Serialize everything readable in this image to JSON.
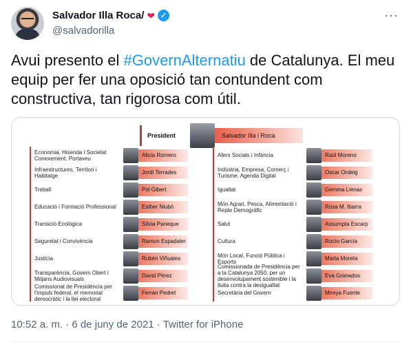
{
  "author": {
    "display_name": "Salvador Illa Roca/",
    "handle": "@salvadorilla",
    "more_label": "···"
  },
  "tweet": {
    "text_before": "Avui presento el ",
    "hashtag": "#GovernAlternatiu",
    "text_after": " de Catalunya. El meu equip per fer una oposició tan contundent com constructiva, tan rigorosa com útil."
  },
  "media": {
    "president": {
      "label": "President",
      "name": "Salvador Illa i Roca"
    },
    "left": [
      {
        "dept": "Economia, Hisenda i Societat Conexement. Portaveu",
        "name": "Alicia Romero"
      },
      {
        "dept": "Infraestructures, Territori i Habitatge",
        "name": "Jordi Terrades"
      },
      {
        "dept": "Treball",
        "name": "Pol Gibert"
      },
      {
        "dept": "Educació i Formació Professional",
        "name": "Esther Niubó"
      },
      {
        "dept": "Transició Ecològica",
        "name": "Sílvia Paneque"
      },
      {
        "dept": "Seguretat i Convivència",
        "name": "Ramon Espadaler"
      },
      {
        "dept": "Justícia",
        "name": "Rubén Viñuales"
      },
      {
        "dept": "Transparència, Govern Obert i Mitjans Audiovisuals",
        "name": "David Pérez"
      },
      {
        "dept": "Comissionat de Presidència per l'impuls federal, el memorial democràtic i la llei electoral",
        "name": "Ferran Pedret"
      }
    ],
    "right": [
      {
        "dept": "Afers Socials i Infància",
        "name": "Raül Moreno"
      },
      {
        "dept": "Indústria, Empresa, Comerç i Turisme. Agenda Digital",
        "name": "Oscar Ordeig"
      },
      {
        "dept": "Igualtat",
        "name": "Gemma Lienas"
      },
      {
        "dept": "Món Agrari, Pesca, Alimentació i Repte Demogràfic",
        "name": "Rosa M. Ibarra"
      },
      {
        "dept": "Salut",
        "name": "Assumpta Escarp"
      },
      {
        "dept": "Cultura",
        "name": "Rocío García"
      },
      {
        "dept": "Món Local, Funció Pública i Esports",
        "name": "Marta Moreta"
      },
      {
        "dept": "Comissionada de Presidència per a la Catalunya 2050, per un desenvolupament sostenible i la lluita contra la desigualtat",
        "name": "Eva Granados"
      },
      {
        "dept": "Secretària del Govern",
        "name": "Mireya Fuente"
      }
    ]
  },
  "footer": {
    "timestamp": "10:52 a. m. · 6 de juny de 2021 · Twitter for iPhone"
  },
  "colors": {
    "link": "#1d9bf0",
    "accent_red": "#c0392b",
    "verified": "#1d9bf0"
  }
}
